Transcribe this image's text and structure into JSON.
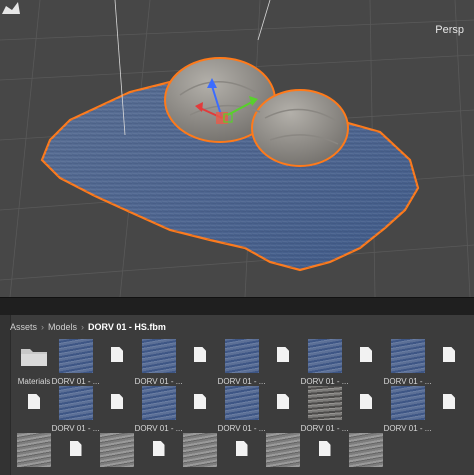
{
  "scene_view": {
    "camera_mode_label": "Persp",
    "selection_outline_color": "#ff7a1a",
    "background_color": "#474747"
  },
  "project": {
    "breadcrumb": [
      "Assets",
      "Models",
      "DORV 01 - HS.fbm"
    ],
    "assets": [
      {
        "type": "folder",
        "label": "Materials"
      },
      {
        "type": "texture",
        "tone": "blue",
        "label": "DORV 01 - ..."
      },
      {
        "type": "file",
        "label": ""
      },
      {
        "type": "texture",
        "tone": "blue",
        "label": "DORV 01 - ..."
      },
      {
        "type": "file",
        "label": ""
      },
      {
        "type": "texture",
        "tone": "blue",
        "label": "DORV 01 - ..."
      },
      {
        "type": "file",
        "label": ""
      },
      {
        "type": "texture",
        "tone": "blue",
        "label": "DORV 01 - ..."
      },
      {
        "type": "file",
        "label": ""
      },
      {
        "type": "texture",
        "tone": "blue",
        "label": "DORV 01 - ..."
      },
      {
        "type": "file",
        "label": ""
      },
      {
        "type": "file",
        "label": ""
      },
      {
        "type": "texture",
        "tone": "blue",
        "label": "DORV 01 - ..."
      },
      {
        "type": "file",
        "label": ""
      },
      {
        "type": "texture",
        "tone": "blue",
        "label": "DORV 01 - ..."
      },
      {
        "type": "file",
        "label": ""
      },
      {
        "type": "texture",
        "tone": "blue",
        "label": "DORV 01 - ..."
      },
      {
        "type": "file",
        "label": ""
      },
      {
        "type": "texture",
        "tone": "rock",
        "label": "DORV 01 - ..."
      },
      {
        "type": "file",
        "label": ""
      },
      {
        "type": "texture",
        "tone": "blue",
        "label": "DORV 01 - ..."
      },
      {
        "type": "file",
        "label": ""
      },
      {
        "type": "texture",
        "tone": "grey",
        "label": ""
      },
      {
        "type": "file",
        "label": ""
      },
      {
        "type": "texture",
        "tone": "grey",
        "label": ""
      },
      {
        "type": "file",
        "label": ""
      },
      {
        "type": "texture",
        "tone": "grey",
        "label": ""
      },
      {
        "type": "file",
        "label": ""
      },
      {
        "type": "texture",
        "tone": "grey",
        "label": ""
      },
      {
        "type": "file",
        "label": ""
      },
      {
        "type": "texture",
        "tone": "grey",
        "label": ""
      }
    ]
  }
}
